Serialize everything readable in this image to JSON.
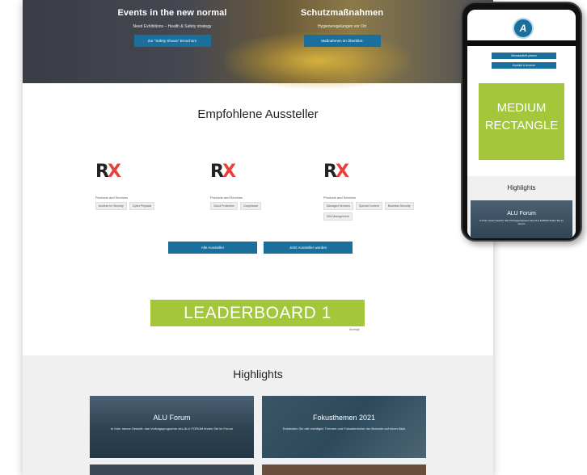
{
  "hero": {
    "left": {
      "title": "Events in the new normal",
      "subtitle": "Need Exhibitions – Health & Safety strategy",
      "button": "Zur \"Safety Shows\" Broschüre"
    },
    "right": {
      "title": "Schutzmaßnahmen",
      "subtitle": "Hygieneregelungen vor Ort",
      "button": "Maßnahmen im Überblick"
    }
  },
  "exhibitors": {
    "title": "Empfohlene Aussteller",
    "items": [
      {
        "logo": "RX",
        "label": "Products and Services",
        "tags": [
          "Auslese im Security",
          "Cyber Physical"
        ]
      },
      {
        "logo": "RX",
        "label": "Products and Services",
        "tags": [
          "Cloud Protection",
          "Compliance"
        ]
      },
      {
        "logo": "RX",
        "label": "Products and Services",
        "tags": [
          "Managed Services",
          "Special Content",
          "Business Security",
          "SIM Management"
        ]
      }
    ],
    "buttons": {
      "all": "Alle Aussteller",
      "become": "Jetzt Aussteller werden"
    }
  },
  "ads": {
    "leaderboard": "LEADERBOARD 1",
    "note": "Anzeige",
    "rectangle_line1": "MEDIUM",
    "rectangle_line2": "RECTANGLE"
  },
  "highlights": {
    "title": "Highlights",
    "cards": [
      {
        "title": "ALU Forum",
        "text": "In Ihrer neues Gesicht: das Vortragsprogramm des ALU FORUM finden Sie im Forum"
      },
      {
        "title": "Fokusthemen 2021",
        "text": "Entdecken Sie alle wichtigen Themen und Fokusbereiche der Branche auf einen Blick"
      }
    ]
  },
  "mobile": {
    "logo": "A",
    "buttons": [
      "Messeauftritt planen",
      "Kontakt & Anreise"
    ],
    "highlights_title": "Highlights",
    "card_title": "ALU Forum",
    "card_text": "In Ihrer neues Gesicht: das Vortragsprogramm des ALU FORUM finden Sie im Forum"
  },
  "colors": {
    "accent": "#1b6f9c",
    "ad_green": "#a3c63a",
    "rx_red": "#e8403a"
  }
}
